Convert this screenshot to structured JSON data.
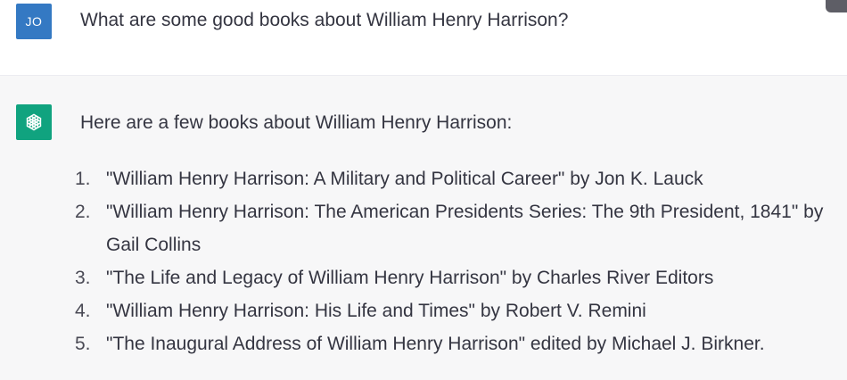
{
  "user_message": {
    "avatar_initials": "JO",
    "text": "What are some good books about William Henry Harrison?"
  },
  "assistant_message": {
    "avatar_icon": "openai-logo-icon",
    "intro": "Here are a few books about William Henry Harrison:",
    "books": [
      {
        "number": "1.",
        "text": "\"William Henry Harrison: A Military and Political Career\" by Jon K. Lauck"
      },
      {
        "number": "2.",
        "text": "\"William Henry Harrison: The American Presidents Series: The 9th President, 1841\" by Gail Collins"
      },
      {
        "number": "3.",
        "text": "\"The Life and Legacy of William Henry Harrison\" by Charles River Editors"
      },
      {
        "number": "4.",
        "text": "\"William Henry Harrison: His Life and Times\" by Robert V. Remini"
      },
      {
        "number": "5.",
        "text": "\"The Inaugural Address of William Henry Harrison\" edited by Michael J. Birkner."
      }
    ]
  },
  "colors": {
    "user_avatar_bg": "#3479c3",
    "assistant_avatar_bg": "#10a37f",
    "assistant_row_bg": "#f7f7f8",
    "text": "#343541"
  }
}
